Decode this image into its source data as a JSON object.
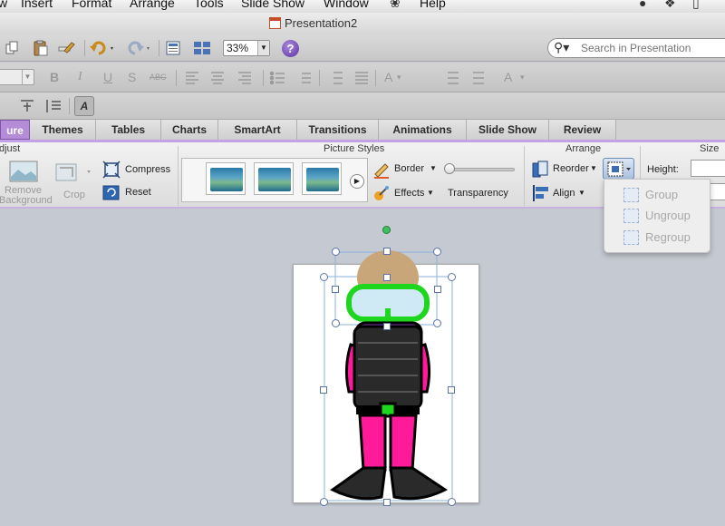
{
  "menubar": {
    "items": [
      "w",
      "Insert",
      "Format",
      "Arrange",
      "Tools",
      "Slide Show",
      "Window",
      "Help"
    ]
  },
  "window": {
    "title": "Presentation2"
  },
  "toolbar": {
    "zoom": "33%",
    "help": "?",
    "search_placeholder": "Search in Presentation"
  },
  "formatting": {
    "bold": "B",
    "italic": "I",
    "underline": "U",
    "shadow": "S",
    "strikethrough": "ABC",
    "grow_font": "A",
    "text_color": "A",
    "text_direction": "A"
  },
  "ribbon_tabs": [
    {
      "label": "ure",
      "active": true
    },
    {
      "label": "Themes",
      "active": false
    },
    {
      "label": "Tables",
      "active": false
    },
    {
      "label": "Charts",
      "active": false
    },
    {
      "label": "SmartArt",
      "active": false
    },
    {
      "label": "Transitions",
      "active": false
    },
    {
      "label": "Animations",
      "active": false
    },
    {
      "label": "Slide Show",
      "active": false
    },
    {
      "label": "Review",
      "active": false
    }
  ],
  "ribbon": {
    "adjust": {
      "title": "djust",
      "remove_background_1": "Remove",
      "remove_background_2": "Background",
      "crop": "Crop",
      "compress": "Compress",
      "reset": "Reset"
    },
    "picture_styles": {
      "title": "Picture Styles",
      "border": "Border",
      "effects": "Effects",
      "transparency": "Transparency",
      "transparency_level": 0
    },
    "arrange": {
      "title": "Arrange",
      "reorder": "Reorder",
      "align": "Align"
    },
    "size": {
      "title": "Size",
      "height_label": "Height:"
    }
  },
  "group_menu": {
    "items": [
      {
        "label": "Group",
        "enabled": false
      },
      {
        "label": "Ungroup",
        "enabled": false
      },
      {
        "label": "Regroup",
        "enabled": false
      }
    ]
  },
  "colors": {
    "accent_tab": "#b58cd8",
    "ribbon_border": "#c3a1e6",
    "diver_suit_pink": "#ff1a9a",
    "diver_mask_green": "#1ed61e",
    "diver_vest": "#2a2a2a"
  }
}
